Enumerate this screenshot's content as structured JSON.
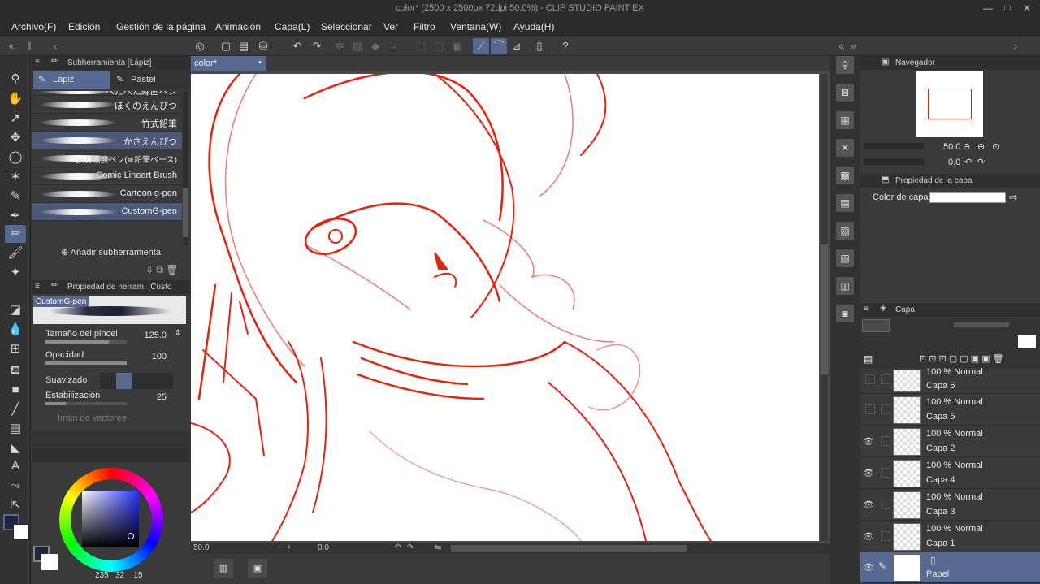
{
  "window": {
    "title": "color* (2500 x 2500px 72dpi 50.0%) - CLIP STUDIO PAINT EX"
  },
  "menu": [
    "Archivo(F)",
    "Edición",
    "Gestión de la página",
    "Animación",
    "Capa(L)",
    "Seleccionar",
    "Ver",
    "Filtro",
    "Ventana(W)",
    "Ayuda(H)"
  ],
  "subtool_panel": {
    "header": "Subherramienta [Lápiz]",
    "tabs": [
      "Lápiz",
      "Pastel"
    ],
    "brushes": [
      "べたべた線画ペン",
      "ぼくのえんぴつ",
      "竹式鉛筆",
      "かさえんぴつ",
      "張弱濃淡ペン(≒鉛筆ベース)",
      "Comic Lineart Brush",
      "Cartoon g-pen",
      "CustomG-pen"
    ],
    "selected_brush": "CustomG-pen",
    "add_label": "Añadir subherramienta"
  },
  "tool_property": {
    "header": "Propiedad de herram. [Custo",
    "preview_label": "CustomG-pen",
    "brush_size": {
      "label": "Tamaño del pincel",
      "value": "125.0"
    },
    "opacity": {
      "label": "Opacidad",
      "value": "100"
    },
    "smoothing_label": "Suavizado",
    "stabilization": {
      "label": "Estabilización",
      "value": "25"
    },
    "vector_magnet_label": "Imán de vectores"
  },
  "color": {
    "h": "235",
    "s": "32",
    "v": "15"
  },
  "document": {
    "tab_label": "color*",
    "zoom": "50.0",
    "angle": "0.0"
  },
  "navigator": {
    "header": "Navegador",
    "zoom": "50.0",
    "rotation": "0.0"
  },
  "layer_property": {
    "header": "Propiedad de la capa",
    "color_label": "Color de capa"
  },
  "layer_panel": {
    "header": "Capa",
    "layers": [
      {
        "mode": "100 % Normal",
        "name": "Capa 6",
        "visible": false,
        "selected": false
      },
      {
        "mode": "100 % Normal",
        "name": "Capa 5",
        "visible": false,
        "selected": false
      },
      {
        "mode": "100 % Normal",
        "name": "Capa 2",
        "visible": true,
        "selected": false
      },
      {
        "mode": "100 % Normal",
        "name": "Capa 4",
        "visible": true,
        "selected": false
      },
      {
        "mode": "100 % Normal",
        "name": "Capa 3",
        "visible": true,
        "selected": false
      },
      {
        "mode": "100 % Normal",
        "name": "Capa 1",
        "visible": true,
        "selected": false
      },
      {
        "mode": "",
        "name": "Papel",
        "visible": true,
        "selected": true
      }
    ]
  },
  "colors": {
    "accent": "#566a91",
    "panel": "#3a3a3a",
    "sketch": "#e8200c"
  }
}
